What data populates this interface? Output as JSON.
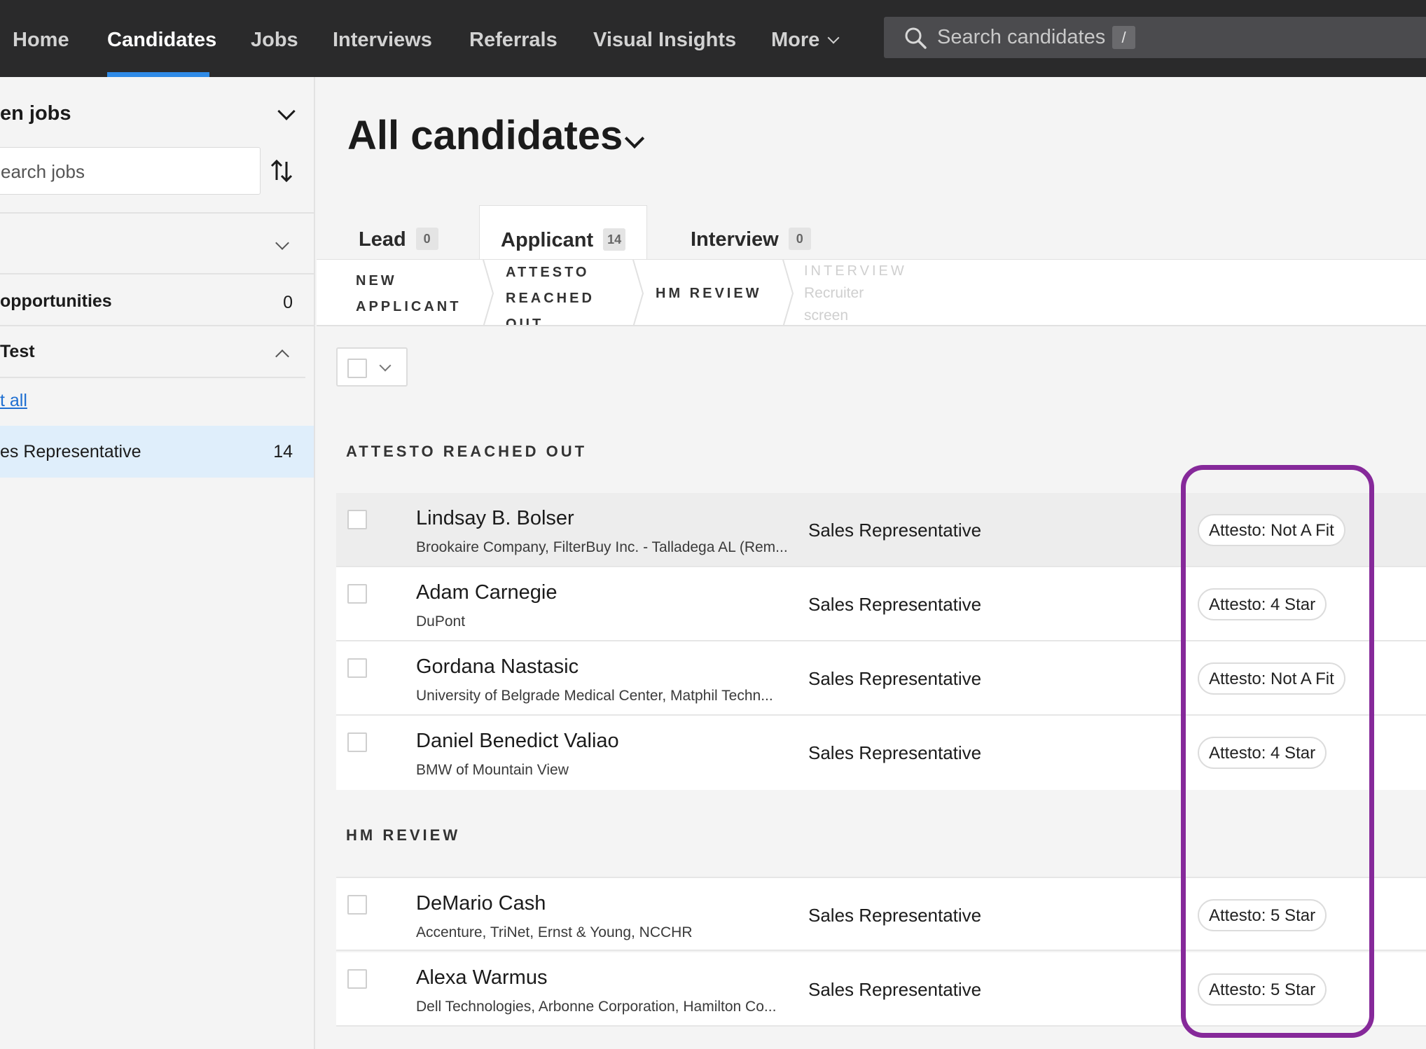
{
  "nav": {
    "items": [
      "Home",
      "Candidates",
      "Jobs",
      "Interviews",
      "Referrals",
      "Visual Insights",
      "More"
    ],
    "active": "Candidates",
    "search_placeholder": "Search candidates",
    "search_shortcut": "/"
  },
  "sidebar": {
    "title": "en jobs",
    "search_placeholder": "earch jobs",
    "opportunities_label": "opportunities",
    "opportunities_count": "0",
    "group_label": "Test",
    "link_label": "t all",
    "selected_job_label": "es Representative",
    "selected_job_count": "14"
  },
  "main": {
    "title": "All candidates",
    "tabs": [
      {
        "label": "Lead",
        "count": "0"
      },
      {
        "label": "Applicant",
        "count": "14"
      },
      {
        "label": "Interview",
        "count": "0"
      }
    ],
    "stages": [
      {
        "line1": "NEW",
        "line2": "APPLICANT",
        "line3": ""
      },
      {
        "line1": "ATTESTO",
        "line2": "REACHED",
        "line3": "OUT"
      },
      {
        "line1": "HM REVIEW",
        "line2": "",
        "line3": ""
      },
      {
        "line1": "INTERVIEW",
        "line2": "Recruiter",
        "line3": "screen"
      }
    ],
    "sections": [
      {
        "header": "ATTESTO REACHED OUT",
        "rows": [
          {
            "name": "Lindsay B. Bolser",
            "sub": "Brookaire Company, FilterBuy Inc. - Talladega AL (Rem...",
            "job": "Sales Representative",
            "tag": "Attesto: Not A Fit"
          },
          {
            "name": "Adam Carnegie",
            "sub": "DuPont",
            "job": "Sales Representative",
            "tag": "Attesto: 4 Star"
          },
          {
            "name": "Gordana Nastasic",
            "sub": "University of Belgrade Medical Center, Matphil Techn...",
            "job": "Sales Representative",
            "tag": "Attesto: Not A Fit"
          },
          {
            "name": "Daniel Benedict Valiao",
            "sub": "BMW of Mountain View",
            "job": "Sales Representative",
            "tag": "Attesto: 4 Star"
          }
        ]
      },
      {
        "header": "HM REVIEW",
        "rows": [
          {
            "name": "DeMario Cash",
            "sub": "Accenture, TriNet, Ernst & Young, NCCHR",
            "job": "Sales Representative",
            "tag": "Attesto: 5 Star"
          },
          {
            "name": "Alexa Warmus",
            "sub": "Dell Technologies, Arbonne Corporation, Hamilton Co...",
            "job": "Sales Representative",
            "tag": "Attesto: 5 Star"
          }
        ]
      }
    ]
  },
  "colors": {
    "nav_bg": "#2a2a2b",
    "nav_accent": "#2f8ae6",
    "highlight": "#86299a",
    "selected_bg": "#dfeefb",
    "link": "#1f6fd1"
  }
}
